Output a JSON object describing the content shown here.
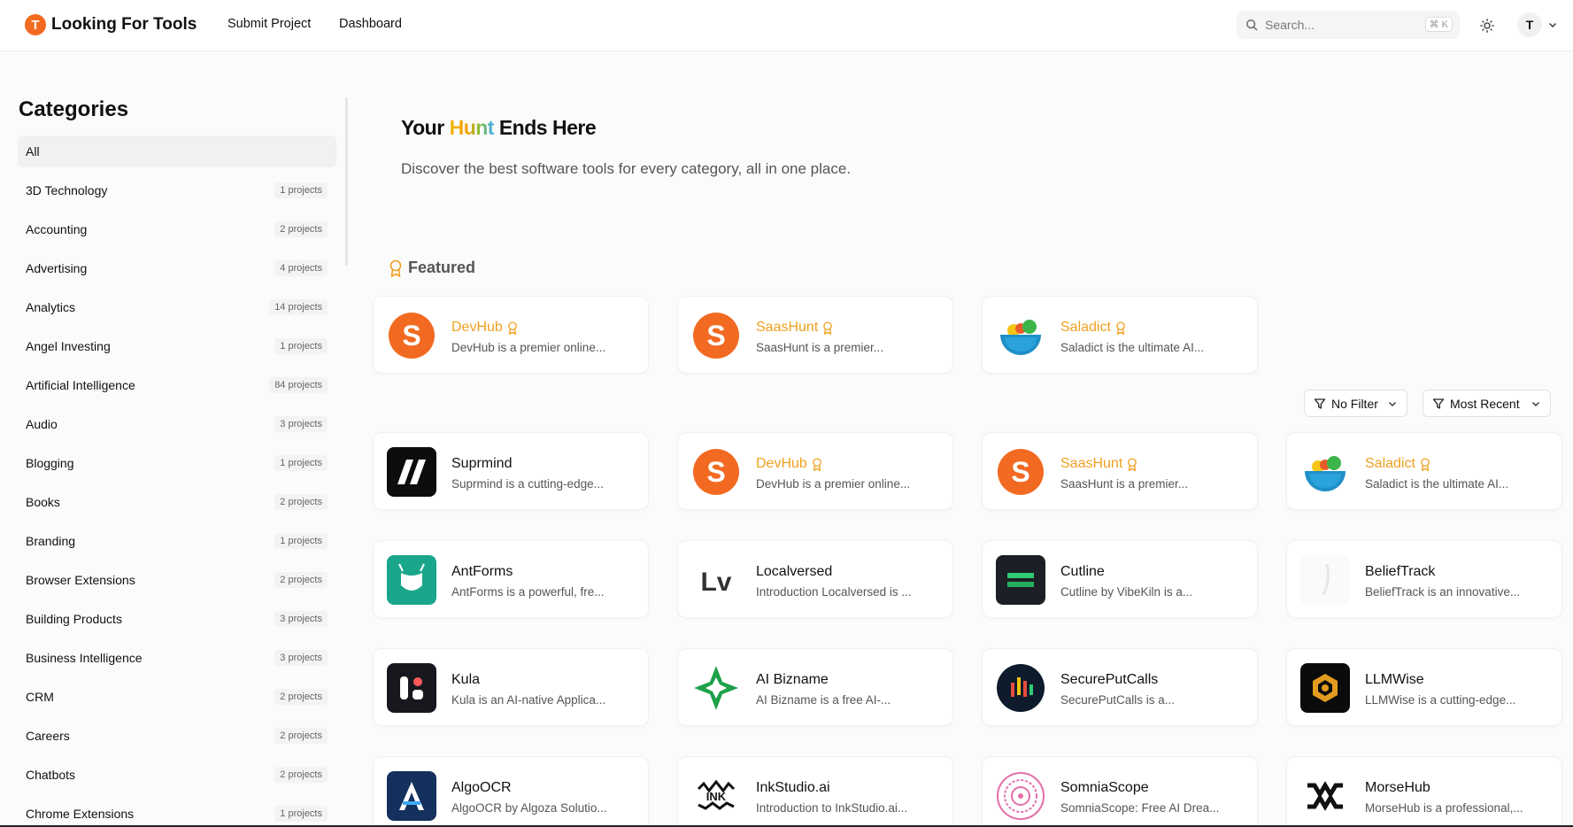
{
  "header": {
    "logo_letter": "T",
    "logo_text": "Looking For Tools",
    "nav": [
      "Submit Project",
      "Dashboard"
    ],
    "search_placeholder": "Search...",
    "search_shortcut": "⌘ K",
    "avatar_letter": "T"
  },
  "sidebar": {
    "title": "Categories",
    "items": [
      {
        "label": "All",
        "count": ""
      },
      {
        "label": "3D Technology",
        "count": "1 projects"
      },
      {
        "label": "Accounting",
        "count": "2 projects"
      },
      {
        "label": "Advertising",
        "count": "4 projects"
      },
      {
        "label": "Analytics",
        "count": "14 projects"
      },
      {
        "label": "Angel Investing",
        "count": "1 projects"
      },
      {
        "label": "Artificial Intelligence",
        "count": "84 projects"
      },
      {
        "label": "Audio",
        "count": "3 projects"
      },
      {
        "label": "Blogging",
        "count": "1 projects"
      },
      {
        "label": "Books",
        "count": "2 projects"
      },
      {
        "label": "Branding",
        "count": "1 projects"
      },
      {
        "label": "Browser Extensions",
        "count": "2 projects"
      },
      {
        "label": "Building Products",
        "count": "3 projects"
      },
      {
        "label": "Business Intelligence",
        "count": "3 projects"
      },
      {
        "label": "CRM",
        "count": "2 projects"
      },
      {
        "label": "Careers",
        "count": "2 projects"
      },
      {
        "label": "Chatbots",
        "count": "2 projects"
      },
      {
        "label": "Chrome Extensions",
        "count": "1 projects"
      }
    ]
  },
  "hero": {
    "title_pre": "Your ",
    "title_hl": "Hunt",
    "title_post": " Ends Here",
    "subtitle": "Discover the best software tools for every category, all in one place."
  },
  "featured": {
    "label": "Featured",
    "cards": [
      {
        "name": "DevHub",
        "desc": "DevHub is a premier online...",
        "logo": "s-logo",
        "featured": true
      },
      {
        "name": "SaasHunt",
        "desc": "SaasHunt is a premier...",
        "logo": "s-logo",
        "featured": true
      },
      {
        "name": "Saladict",
        "desc": "Saladict is the ultimate AI...",
        "logo": "bowl-logo",
        "featured": true
      }
    ]
  },
  "filters": {
    "filter_label": "No Filter",
    "sort_label": "Most Recent"
  },
  "projects": [
    {
      "name": "Suprmind",
      "desc": "Suprmind is a cutting-edge...",
      "logo": "slash-logo",
      "featured": false
    },
    {
      "name": "DevHub",
      "desc": "DevHub is a premier online...",
      "logo": "s-logo",
      "featured": true
    },
    {
      "name": "SaasHunt",
      "desc": "SaasHunt is a premier...",
      "logo": "s-logo",
      "featured": true
    },
    {
      "name": "Saladict",
      "desc": "Saladict is the ultimate AI...",
      "logo": "bowl-logo",
      "featured": true
    },
    {
      "name": "AntForms",
      "desc": "AntForms is a powerful, fre...",
      "logo": "antforms-logo",
      "featured": false
    },
    {
      "name": "Localversed",
      "desc": "Introduction Localversed is ...",
      "logo": "lv-logo",
      "featured": false
    },
    {
      "name": "Cutline",
      "desc": "Cutline by VibeKiln is a...",
      "logo": "cutline-logo",
      "featured": false
    },
    {
      "name": "BeliefTrack",
      "desc": "BeliefTrack is an innovative...",
      "logo": "belief-logo",
      "featured": false
    },
    {
      "name": "Kula",
      "desc": "Kula is an AI-native Applica...",
      "logo": "kula-logo",
      "featured": false
    },
    {
      "name": "AI Bizname",
      "desc": "AI Bizname is a free AI-...",
      "logo": "bizname-logo",
      "featured": false
    },
    {
      "name": "SecurePutCalls",
      "desc": "SecurePutCalls is a...",
      "logo": "secure-logo",
      "featured": false
    },
    {
      "name": "LLMWise",
      "desc": "LLMWise is a cutting-edge...",
      "logo": "llmwise-logo",
      "featured": false
    },
    {
      "name": "AlgoOCR",
      "desc": "AlgoOCR by Algoza Solutio...",
      "logo": "algoocr-logo",
      "featured": false
    },
    {
      "name": "InkStudio.ai",
      "desc": "Introduction to InkStudio.ai...",
      "logo": "inkstudio-logo",
      "featured": false
    },
    {
      "name": "SomniaScope",
      "desc": "SomniaScope: Free AI Drea...",
      "logo": "somnia-logo",
      "featured": false
    },
    {
      "name": "MorseHub",
      "desc": "MorseHub is a professional,...",
      "logo": "morse-logo",
      "featured": false
    }
  ],
  "colors": {
    "accent": "#f26a21",
    "featured_name": "#f0a020"
  }
}
